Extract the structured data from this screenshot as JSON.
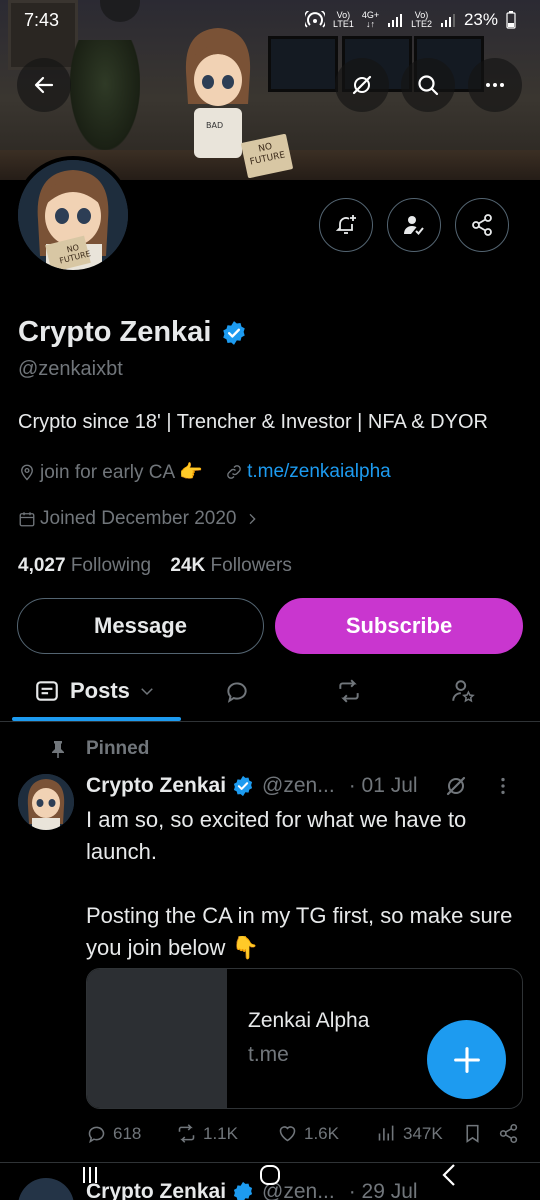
{
  "status_bar": {
    "time": "7:43",
    "network1_top": "Vo)",
    "network1_bottom": "LTE1",
    "network_4g": "4G+",
    "network2_top": "Vo)",
    "network2_bottom": "LTE2",
    "battery": "23%"
  },
  "profile": {
    "name": "Crypto Zenkai",
    "handle": "@zenkaixbt",
    "bio": "Crypto since 18' | Trencher & Investor | NFA & DYOR",
    "location": "join for early CA 👉",
    "website": "t.me/zenkaialpha",
    "joined": "Joined December 2020",
    "following_count": "4,027",
    "following_label": "Following",
    "followers_count": "24K",
    "followers_label": "Followers",
    "message_label": "Message",
    "subscribe_label": "Subscribe",
    "avatar_sign": "NO FUTURE",
    "banner_sign": "NO FUTURE"
  },
  "tabs": {
    "posts_label": "Posts"
  },
  "pinned_post": {
    "pinned_label": "Pinned",
    "author_name": "Crypto Zenkai",
    "author_handle": "@zen...",
    "date": "· 01 Jul",
    "text": "I am so, so excited for what we have to launch.\n\nPosting the CA in my TG first, so make sure you join below 👇",
    "card_title": "Zenkai Alpha",
    "card_domain": "t.me",
    "replies": "618",
    "reposts": "1.1K",
    "likes": "1.6K",
    "views": "347K"
  },
  "next_post": {
    "author_name": "Crypto Zenkai",
    "author_handle": "@zen...",
    "date": "· 29 Jul"
  },
  "colors": {
    "accent": "#1d9bf0",
    "subscribe": "#c936cf",
    "muted": "#71767b",
    "border": "#2f3336"
  }
}
